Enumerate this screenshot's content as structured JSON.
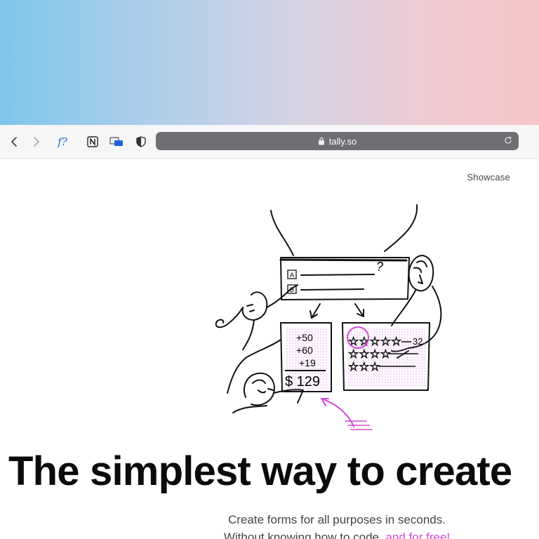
{
  "browser": {
    "url": "tally.so",
    "toolbar_icons": [
      "back-icon",
      "forward-icon",
      "function-extension-icon",
      "notion-extension-icon",
      "tab-extension-icon",
      "shield-extension-icon",
      "lock-icon",
      "reload-icon"
    ],
    "function_ext_label": "f?"
  },
  "page": {
    "nav": {
      "showcase_label": "Showcase"
    },
    "hero": {
      "headline": "The simplest way to create",
      "subtitle_line1": "Create forms for all purposes in seconds.",
      "subtitle_line2_prefix": "Without knowing how to code,",
      "subtitle_line2_accent": "and for free!"
    },
    "illustration": {
      "form_option_a": "A",
      "form_option_b": "B",
      "form_question": "?",
      "calc_values": [
        "+50",
        "+60",
        "+19"
      ],
      "calc_total": "$ 129",
      "rating_value": "32"
    }
  },
  "colors": {
    "accent": "#d24ad8",
    "address_bar": "#6e6e73",
    "toolbar": "#f6f6f7"
  }
}
